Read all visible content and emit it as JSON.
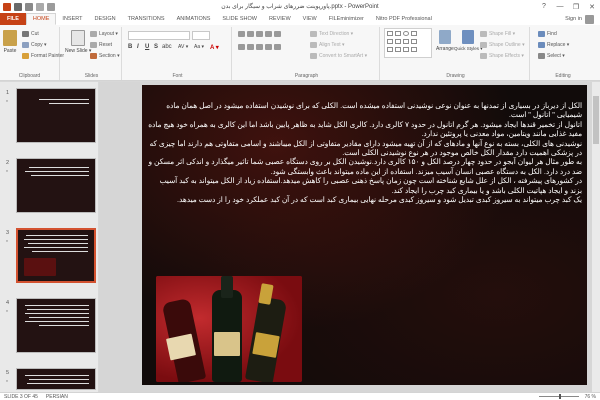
{
  "titlebar": {
    "title": "پاورپوینت ضررهای شراب و سیگار برای بدن.pptx - PowerPoint",
    "minimize": "—",
    "restore": "❐",
    "close": "✕",
    "help": "?"
  },
  "tabs": [
    "FILE",
    "HOME",
    "INSERT",
    "DESIGN",
    "TRANSITIONS",
    "ANIMATIONS",
    "SLIDE SHOW",
    "REVIEW",
    "VIEW",
    "FILEminimizer",
    "Nitro PDF Professional"
  ],
  "active_tab": "HOME",
  "user": {
    "signin": "Sign in"
  },
  "ribbon": {
    "clipboard": {
      "label": "Clipboard",
      "paste": "Paste",
      "cut": "Cut",
      "copy": "Copy ▾",
      "format_painter": "Format Painter"
    },
    "slides": {
      "label": "Slides",
      "new_slide": "New Slide ▾",
      "layout": "Layout ▾",
      "reset": "Reset",
      "section": "Section ▾"
    },
    "font": {
      "label": "Font",
      "bold": "B",
      "italic": "I",
      "underline": "U",
      "strike": "S",
      "shadow": "abc",
      "spacing": "AV ▾",
      "case": "Aa ▾",
      "color": "A ▾"
    },
    "paragraph": {
      "label": "Paragraph",
      "text_direction": "Text Direction ▾",
      "align_text": "Align Text ▾",
      "smartart": "Convert to SmartArt ▾"
    },
    "drawing": {
      "label": "Drawing",
      "arrange": "Arrange",
      "quick_styles": "Quick Styles ▾",
      "shape_fill": "Shape Fill ▾",
      "shape_outline": "Shape Outline ▾",
      "shape_effects": "Shape Effects ▾"
    },
    "editing": {
      "label": "Editing",
      "find": "Find",
      "replace": "Replace ▾",
      "select": "Select ▾"
    }
  },
  "slides_pane": {
    "thumbs": [
      {
        "num": "1",
        "star": "*"
      },
      {
        "num": "2",
        "star": "*"
      },
      {
        "num": "3",
        "star": "*"
      },
      {
        "num": "4",
        "star": "*"
      },
      {
        "num": "5",
        "star": "*"
      }
    ],
    "selected": 3
  },
  "slide": {
    "paragraphs": [
      "الکل از دیرباز در بسیاری از تمدنها به عنوان نوعی نوشیدنی استفاده میشده است. الکلی که برای نوشیدن استفاده میشود در اصل همان ماده شیمیایی \" اتانول \" است.",
      "اتانول از تخمیر قندها ایجاد میشود. هر گرم اتانول در حدود ۷ کالری دارد. کالری الکل شاید به ظاهر پایین باشد اما این کالری به همراه خود هیچ ماده مفید غذایی مانند ویتامین، مواد معدنی یا پروتئین ندارد.",
      "نوشیدنی های الکلی، بسته به نوع آنها و مادهای که از آن تهیه میشود دارای مقادیر متفاوتی از الکل میباشند و اسامی متفاوتی هم دارند اما چیزی که در پزشکی اهمیت دارد مقدار الکل خالص موجود در هر نوع نوشیدنی الکلی است.",
      "به طور مثال هر لیوان آبجو در حدود چهار درصد الکل و ۱۵۰ کالری دارد.نوشیدن الکل بر روی دستگاه عصبی شما تاثیر میگذارد و اندکی اثر مسکن و ضد درد دارد. الکل به دستگاه عصبی انسان آسیب میزند. استفاده از این ماده میتواند باعث وابستگی شود.",
      "در کشورهای پیشرفته ، الکل از علل شایع شناخته است چون زمان پاسخ ذهنی عصبی را کاهش میدهد.استفاده زیاد از الکل میتواند به کبد آسیب بزند و ایجاد هپاتیت الکلی باشد و یا بیماری کبد چرب را ایجاد کند.",
      "یک کبد چرب میتواند به سیروز کبدی تبدیل شود و سیروز کبدی مرحله نهایی بیماری کبد است که در آن کبد عملکرد خود را از دست میدهد."
    ]
  },
  "status": {
    "slide_of": "SLIDE 3 OF 45",
    "language": "PERSIAN",
    "zoom": "76 %"
  },
  "colors": {
    "accent": "#c64216",
    "selected_thumb": "#d35230",
    "slide_bg": "#110b0a"
  }
}
